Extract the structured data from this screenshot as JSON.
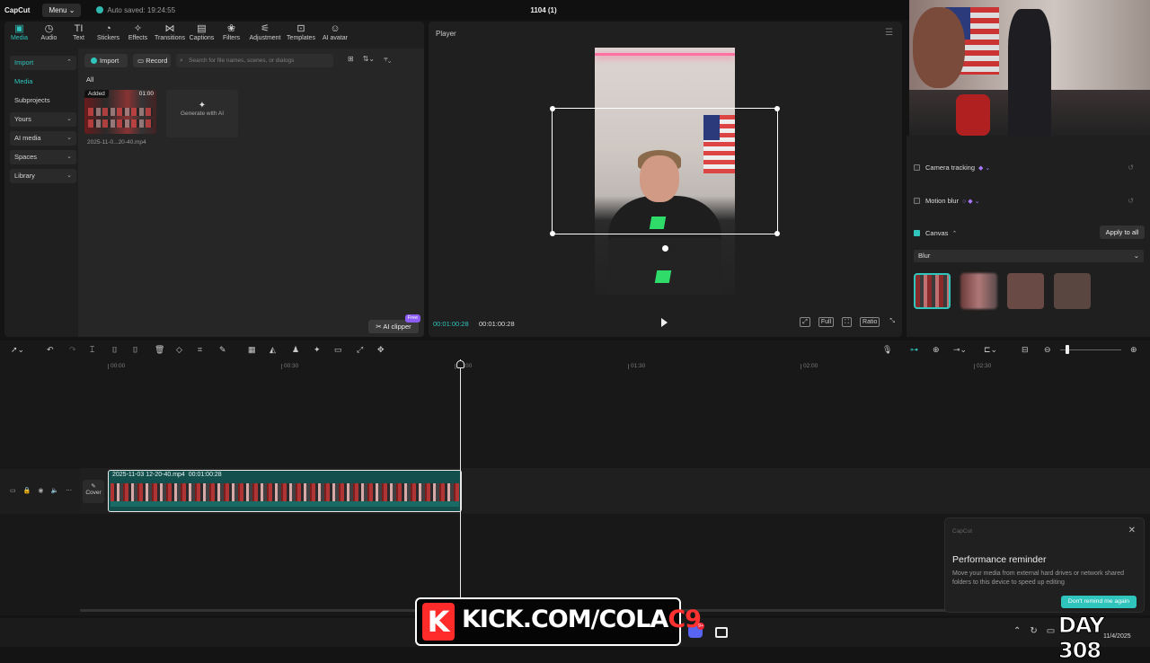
{
  "titlebar": {
    "app_name": "CapCut",
    "menu_label": "Menu",
    "autosave": "Auto saved: 19:24:55",
    "project_title": "1104 (1)"
  },
  "tabs": [
    {
      "label": "Media",
      "icon": "media-icon"
    },
    {
      "label": "Audio",
      "icon": "audio-icon"
    },
    {
      "label": "Text",
      "icon": "text-icon"
    },
    {
      "label": "Stickers",
      "icon": "stickers-icon"
    },
    {
      "label": "Effects",
      "icon": "effects-icon"
    },
    {
      "label": "Transitions",
      "icon": "transitions-icon"
    },
    {
      "label": "Captions",
      "icon": "captions-icon"
    },
    {
      "label": "Filters",
      "icon": "filters-icon"
    },
    {
      "label": "Adjustment",
      "icon": "adjustment-icon"
    },
    {
      "label": "Templates",
      "icon": "templates-icon"
    },
    {
      "label": "AI avatar",
      "icon": "ai-avatar-icon"
    }
  ],
  "sidenav": {
    "import": "Import",
    "media": "Media",
    "subprojects": "Subprojects",
    "yours": "Yours",
    "ai_media": "AI media",
    "spaces": "Spaces",
    "library": "Library"
  },
  "media": {
    "import_label": "Import",
    "record_label": "Record",
    "search_placeholder": "Search for file names, scenes, or dialogs",
    "filter_all": "All",
    "added_tag": "Added",
    "thumb_duration": "01:00",
    "thumb_name": "2025-11-0...20-40.mp4",
    "generate_ai": "Generate with AI",
    "ai_clipper": "AI clipper",
    "free_tag": "Free"
  },
  "player": {
    "title": "Player",
    "current_time": "00:01:00:28",
    "total_time": "00:01:00:28",
    "tool_full": "Full",
    "tool_ratio": "Ratio"
  },
  "right_panel": {
    "camera_tracking": "Camera tracking",
    "motion_blur": "Motion blur",
    "canvas": "Canvas",
    "apply_to_all": "Apply to all",
    "canvas_mode": "Blur"
  },
  "ruler": [
    "00:00",
    "00:30",
    "01:00",
    "01:30",
    "02:00",
    "02:30"
  ],
  "timeline": {
    "clip_name": "2025-11-03 12-20-40.mp4",
    "clip_duration": "00:01:00:28",
    "cover_label": "Cover"
  },
  "notification": {
    "app": "CapCut",
    "title": "Performance reminder",
    "body": "Move your media from external hard drives or network shared folders to this device to speed up editing",
    "button": "Don't remind me again"
  },
  "overlay": {
    "kick_prefix": "KICK.COM/COLA",
    "kick_suffix": "C9",
    "day_counter": "DAY 308"
  },
  "taskbar": {
    "date": "11/4/2025",
    "discord_badge": "9+"
  },
  "colors": {
    "accent": "#2fc4bc",
    "background": "#181818",
    "panel": "#1f1f1f",
    "kick_red": "#ff2a2a"
  }
}
